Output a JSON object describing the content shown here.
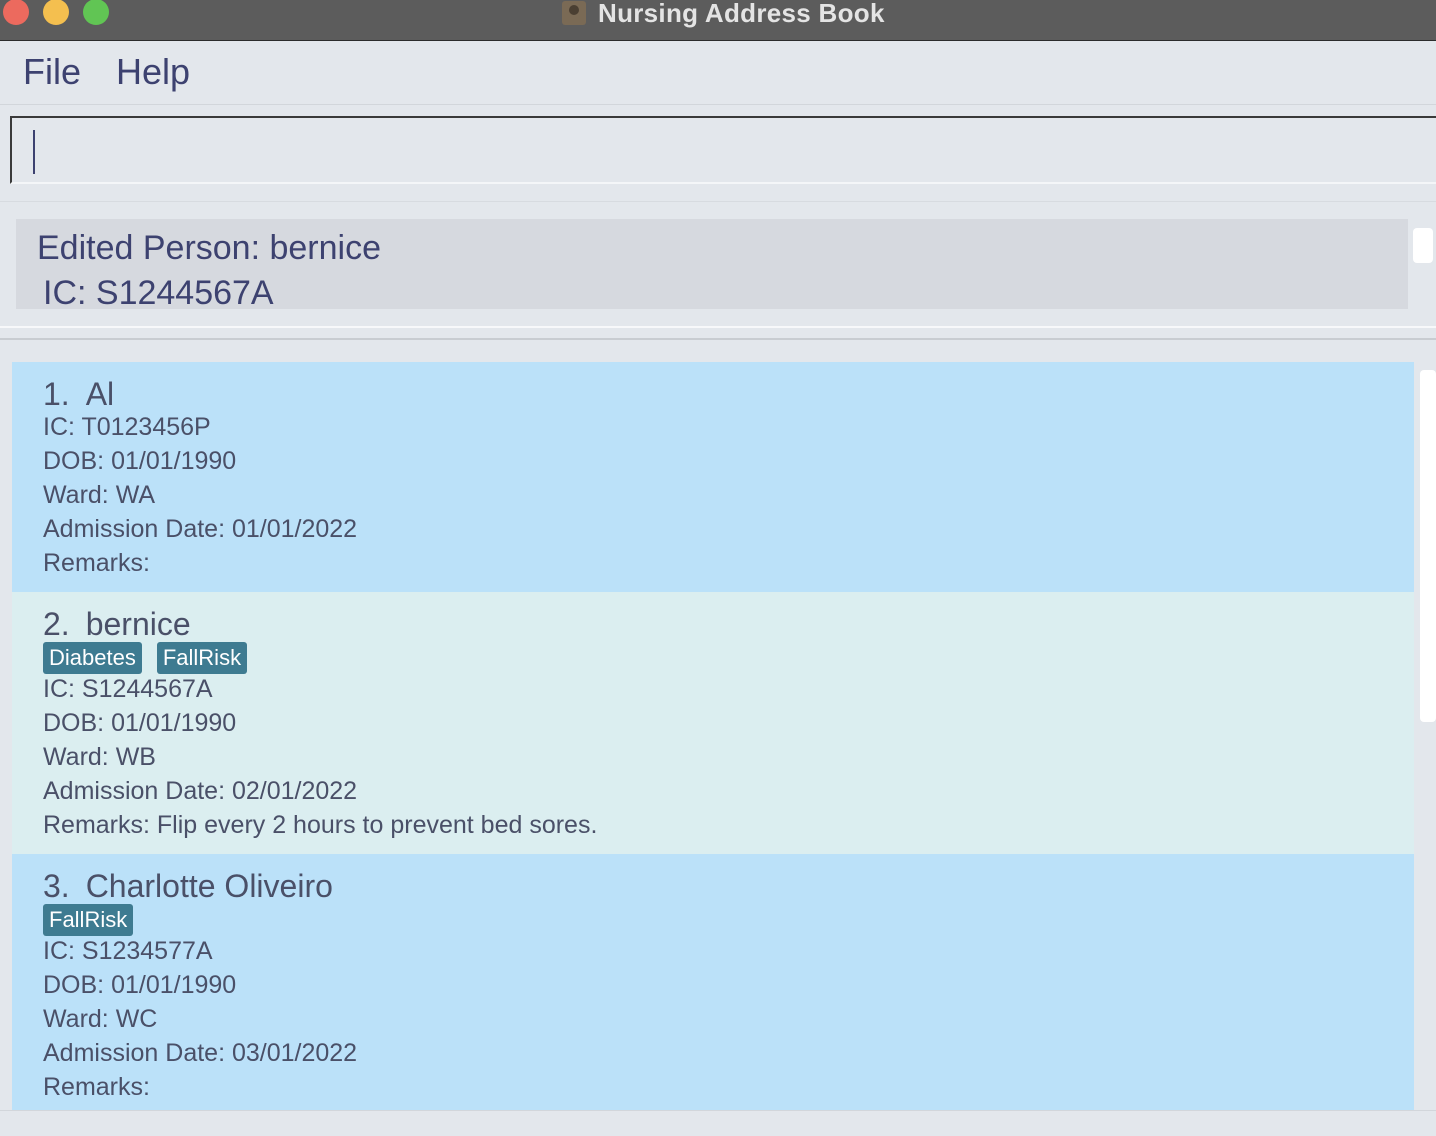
{
  "window": {
    "title": "Nursing Address Book",
    "controls": [
      "close",
      "minimize",
      "maximize"
    ]
  },
  "menu": {
    "file_label": "File",
    "help_label": "Help"
  },
  "command_box": {
    "value": "",
    "placeholder": ""
  },
  "result": {
    "line1": "Edited Person: bernice",
    "line2": "IC: S1244567A"
  },
  "persons": [
    {
      "index": "1.",
      "name": "Al",
      "tags": [],
      "ic": "IC: T0123456P",
      "dob": "DOB: 01/01/1990",
      "ward": "Ward: WA",
      "admission": "Admission Date: 01/01/2022",
      "remarks": "Remarks:"
    },
    {
      "index": "2.",
      "name": "bernice",
      "tags": [
        "Diabetes",
        "FallRisk"
      ],
      "ic": "IC: S1244567A",
      "dob": "DOB: 01/01/1990",
      "ward": "Ward: WB",
      "admission": "Admission Date: 02/01/2022",
      "remarks": "Remarks: Flip every 2 hours to prevent bed sores."
    },
    {
      "index": "3.",
      "name": "Charlotte Oliveiro",
      "tags": [
        "FallRisk"
      ],
      "ic": "IC: S1234577A",
      "dob": "DOB: 01/01/1990",
      "ward": "Ward: WC",
      "admission": "Admission Date: 03/01/2022",
      "remarks": "Remarks:"
    }
  ],
  "colors": {
    "card_selected": "#bbe1f9",
    "card_alt": "#dbeef0",
    "tag": "#3e7b91",
    "text": "#4a5068",
    "menu_text": "#3d4270"
  }
}
